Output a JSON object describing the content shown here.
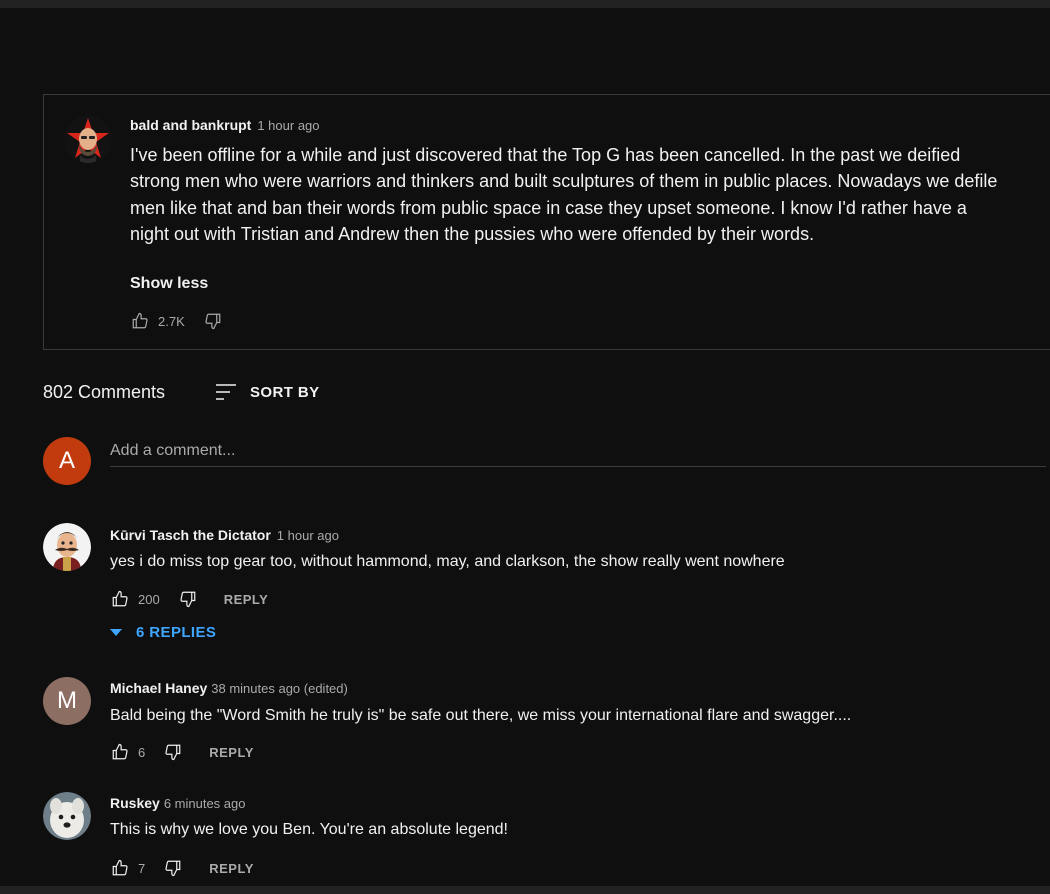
{
  "pinned_comment": {
    "author": "bald and bankrupt",
    "time": "1 hour ago",
    "text": "I've been offline for a while and just discovered that the Top G has been cancelled. In the past we deified strong men who were warriors and thinkers and built sculptures of them in public places. Nowadays we defile men like that and ban their words from public space in case they upset someone. I know I'd rather have a night out with Tristian and Andrew then the pussies who were offended by their words.",
    "show_less_label": "Show less",
    "likes": "2.7K",
    "avatar_icon": "red-star-bald-man-avatar"
  },
  "header": {
    "comments_count": "802 Comments",
    "sort_label": "SORT BY"
  },
  "add_comment": {
    "avatar_letter": "A",
    "avatar_color": "#c23b0e",
    "placeholder": "Add a comment..."
  },
  "comments": [
    {
      "author": "Kūrvi Tasch the Dictator",
      "time": "1 hour ago",
      "text": "yes i do miss top gear too, without hammond, may, and clarkson, the show really went nowhere",
      "likes": "200",
      "reply_label": "REPLY",
      "replies_label": "6 REPLIES",
      "avatar_icon": "mustached-dictator-avatar"
    },
    {
      "author": "Michael Haney",
      "time": "38 minutes ago (edited)",
      "text": "Bald being the \"Word Smith he truly is\" be safe out there,  we miss your international flare and swagger....",
      "likes": "6",
      "reply_label": "REPLY",
      "avatar_letter": "M",
      "avatar_color": "#8d6e63"
    },
    {
      "author": "Ruskey",
      "time": "6 minutes ago",
      "text": "This is why we love you Ben. You're an absolute legend!",
      "likes": "7",
      "reply_label": "REPLY",
      "avatar_icon": "white-dog-avatar"
    }
  ],
  "colors": {
    "background": "#0f0f0f",
    "text": "#f1f1f1",
    "secondary_text": "#aaaaaa",
    "link_blue": "#3ea6ff"
  }
}
